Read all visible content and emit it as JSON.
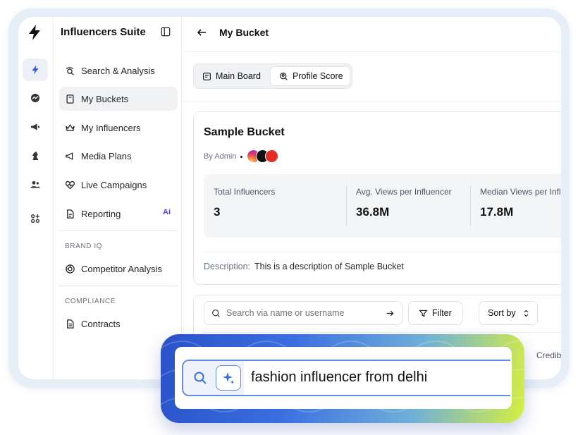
{
  "app": {
    "brand": "Influencers Suite",
    "page_title": "My Bucket",
    "accent_color": "#4f46e5"
  },
  "sidebar": {
    "items": [
      {
        "label": "Search & Analysis",
        "icon": "search-analysis-icon"
      },
      {
        "label": "My Buckets",
        "icon": "bucket-icon",
        "active": true
      },
      {
        "label": "My Influencers",
        "icon": "crown-icon"
      },
      {
        "label": "Media Plans",
        "icon": "megaphone-icon"
      },
      {
        "label": "Live Campaigns",
        "icon": "heart-pulse-icon"
      },
      {
        "label": "Reporting",
        "icon": "report-icon",
        "badge": "Ai"
      }
    ],
    "brand_iq_label": "BRAND IQ",
    "brand_iq_items": [
      {
        "label": "Competitor Analysis",
        "icon": "target-icon"
      }
    ],
    "compliance_label": "COMPLIANCE",
    "compliance_items": [
      {
        "label": "Contracts",
        "icon": "document-icon"
      }
    ]
  },
  "rail": {
    "icons": [
      "bolt-icon",
      "chart-icon",
      "megaphone-icon",
      "chess-knight-icon",
      "users-icon",
      "apps-icon"
    ]
  },
  "tabs": [
    {
      "label": "Main Board",
      "icon": "board-icon"
    },
    {
      "label": "Profile Score",
      "icon": "profile-score-icon",
      "active": true
    }
  ],
  "bucket": {
    "title": "Sample Bucket",
    "by": "By Admin",
    "platforms": [
      "instagram",
      "tiktok",
      "youtube"
    ],
    "stats": [
      {
        "label": "Total Influencers",
        "value": "3"
      },
      {
        "label": "Avg. Views per Influencer",
        "value": "36.8M"
      },
      {
        "label": "Median Views per Influencer",
        "value": "17.8M"
      }
    ],
    "description_label": "Description:",
    "description": "This is a description of Sample Bucket"
  },
  "toolbar": {
    "search_placeholder": "Search via name or username",
    "filter_label": "Filter",
    "sort_label": "Sort by",
    "credibility_label": "Credib"
  },
  "overlay": {
    "query": "fashion influencer from delhi"
  }
}
